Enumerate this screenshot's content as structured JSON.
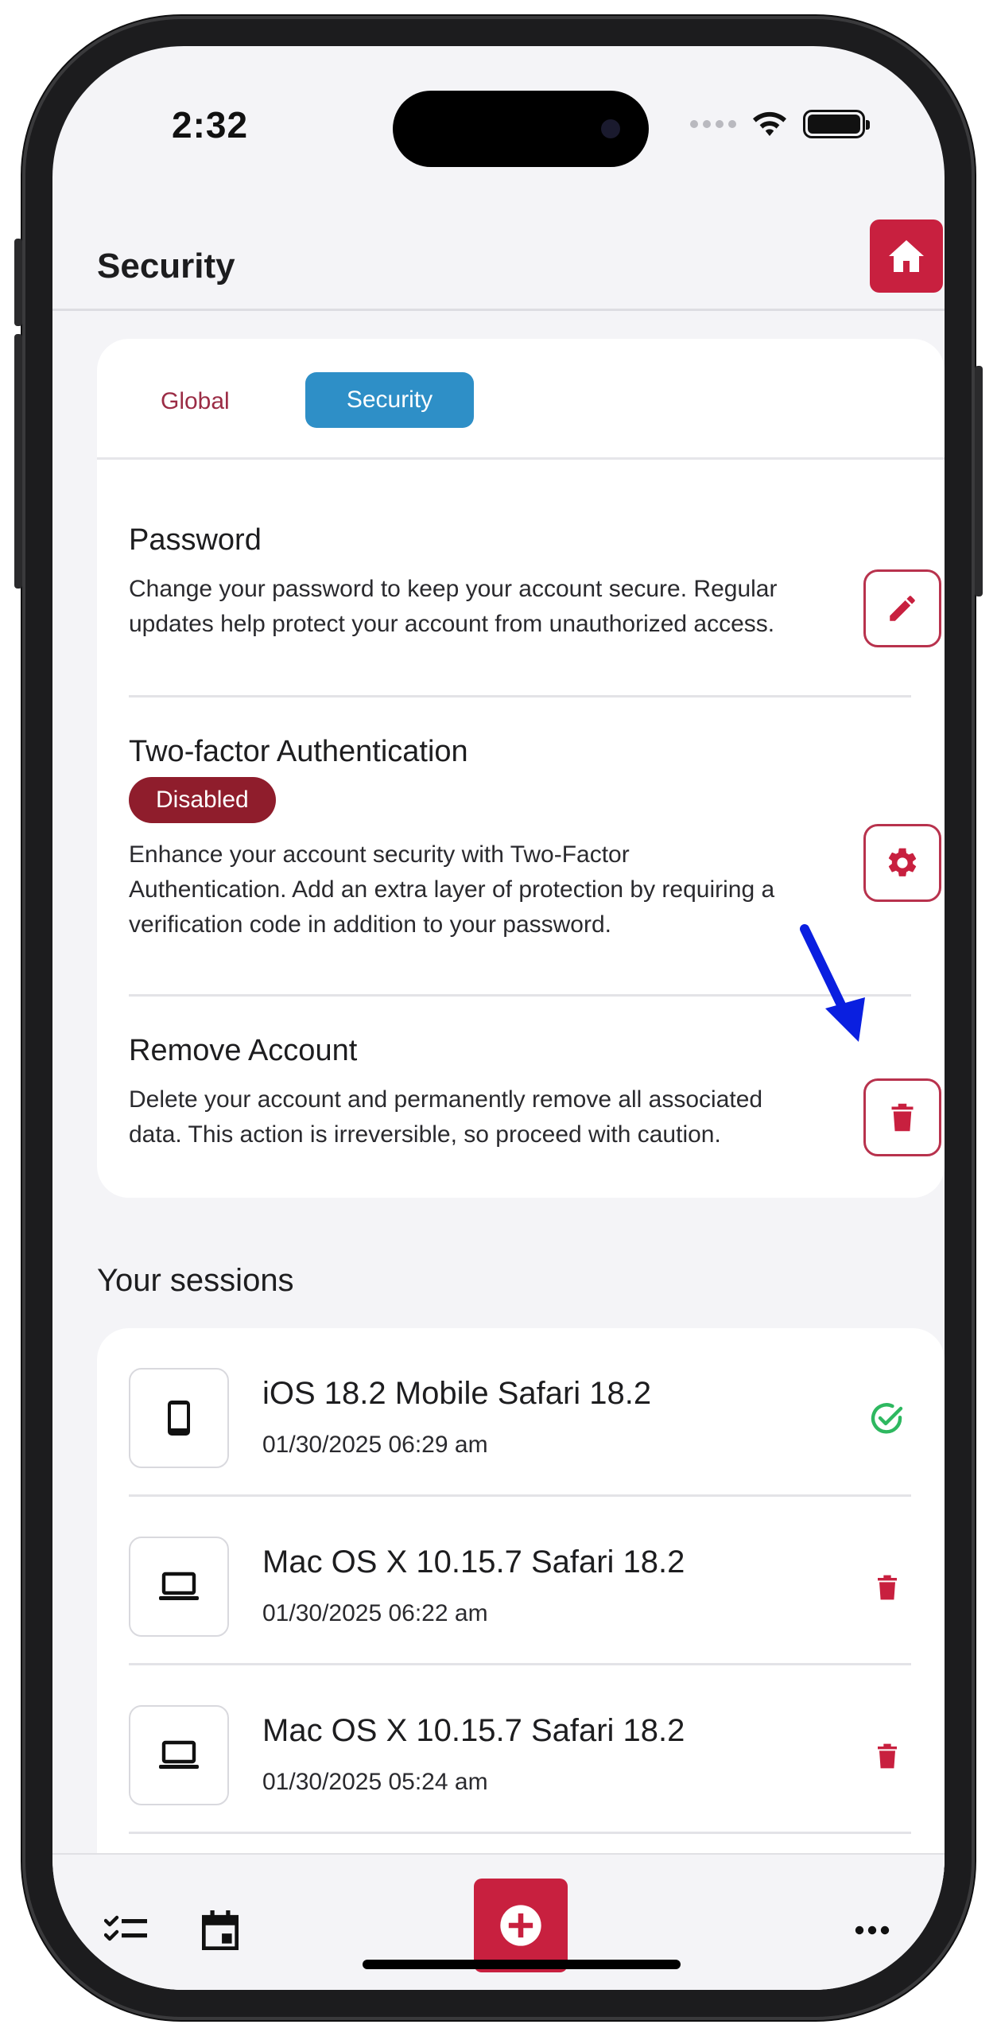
{
  "status_bar": {
    "time": "2:32"
  },
  "header": {
    "title": "Security"
  },
  "tabs": [
    {
      "label": "Global",
      "active": false
    },
    {
      "label": "Security",
      "active": true
    }
  ],
  "security": {
    "password": {
      "title": "Password",
      "description": "Change your password to keep your account secure. Regular updates help protect your account from unauthorized access.",
      "action_icon": "pencil-icon"
    },
    "two_factor": {
      "title": "Two-factor Authentication",
      "badge": "Disabled",
      "description": "Enhance your account security with Two-Factor Authentication. Add an extra layer of protection by requiring a verification code in addition to your password.",
      "action_icon": "gear-icon"
    },
    "remove_account": {
      "title": "Remove Account",
      "description": "Delete your account and permanently remove all associated data. This action is irreversible, so proceed with caution.",
      "action_icon": "trash-icon"
    }
  },
  "sessions": {
    "title": "Your sessions",
    "items": [
      {
        "device": "iOS 18.2 Mobile Safari 18.2",
        "date": "01/30/2025 06:29 am",
        "device_icon": "phone-icon",
        "status": "current",
        "action_icon": "check-circle-icon"
      },
      {
        "device": "Mac OS X 10.15.7 Safari 18.2",
        "date": "01/30/2025 06:22 am",
        "device_icon": "laptop-icon",
        "status": "other",
        "action_icon": "trash-icon"
      },
      {
        "device": "Mac OS X 10.15.7 Safari 18.2",
        "date": "01/30/2025 05:24 am",
        "device_icon": "laptop-icon",
        "status": "other",
        "action_icon": "trash-icon"
      }
    ]
  },
  "bottom_nav": [
    {
      "icon": "checklist-icon"
    },
    {
      "icon": "calendar-icon"
    },
    {
      "icon": "add-circle-icon"
    },
    {
      "icon": "dashboard-icon"
    },
    {
      "icon": "more-icon"
    }
  ],
  "colors": {
    "accent": "#c8203f",
    "tab_active": "#2e8fc7",
    "badge": "#8f1d2c",
    "success": "#2eb860",
    "annotation_arrow": "#0a1fe0"
  }
}
